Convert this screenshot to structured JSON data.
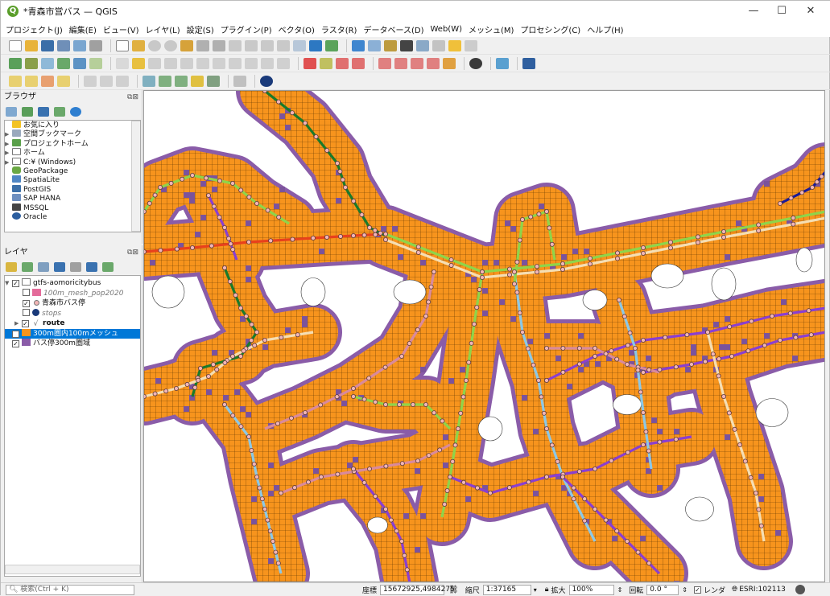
{
  "window": {
    "title": "*青森市営バス — QGIS",
    "logo": "Q",
    "minimize": "—",
    "maximize": "☐",
    "close": "✕"
  },
  "menu": [
    "プロジェクト(J)",
    "編集(E)",
    "ビュー(V)",
    "レイヤ(L)",
    "設定(S)",
    "プラグイン(P)",
    "ベクタ(O)",
    "ラスタ(R)",
    "データベース(D)",
    "Web(W)",
    "メッシュ(M)",
    "プロセシング(C)",
    "ヘルプ(H)"
  ],
  "browser": {
    "title": "ブラウザ",
    "items": [
      "お気に入り",
      "空間ブックマーク",
      "プロジェクトホーム",
      "ホーム",
      "C:¥ (Windows)",
      "GeoPackage",
      "SpatiaLite",
      "PostGIS",
      "SAP HANA",
      "MSSQL",
      "Oracle"
    ]
  },
  "layers": {
    "title": "レイヤ",
    "group": "gtfs-aomoricitybus",
    "mesh_pop": "100m_mesh_pop2020",
    "stop_layer": "青森市バス停",
    "stops": "stops",
    "route": "route",
    "mesh_in": "300m圏内100mメッシュ",
    "buffer": "バス停300m圏域"
  },
  "status": {
    "search_placeholder": "検索(Ctrl + K)",
    "coord_label": "座標",
    "coord_value": "15672925,4984275",
    "scale_label": "縮尺",
    "scale_value": "1:37165",
    "magnify_label": "拡大",
    "magnify_value": "100%",
    "rotation_label": "回転",
    "rotation_value": "0.0 °",
    "render_label": "レンダ",
    "crs": "ESRI:102113"
  },
  "colors": {
    "mesh_orange": "#f7941d",
    "mesh_purple": "#7b539c",
    "buffer_purple": "#8a5ca8",
    "route_darkgreen": "#1a7a2b",
    "route_lime": "#8fd44a",
    "route_pink": "#d98a9c",
    "route_lightblue": "#8cc8e6",
    "route_violet": "#8a3fd1",
    "route_red": "#e8401c",
    "route_navy": "#1a1a9a",
    "route_cream": "#f5deb3",
    "stop_fill": "#f2b5b5"
  }
}
